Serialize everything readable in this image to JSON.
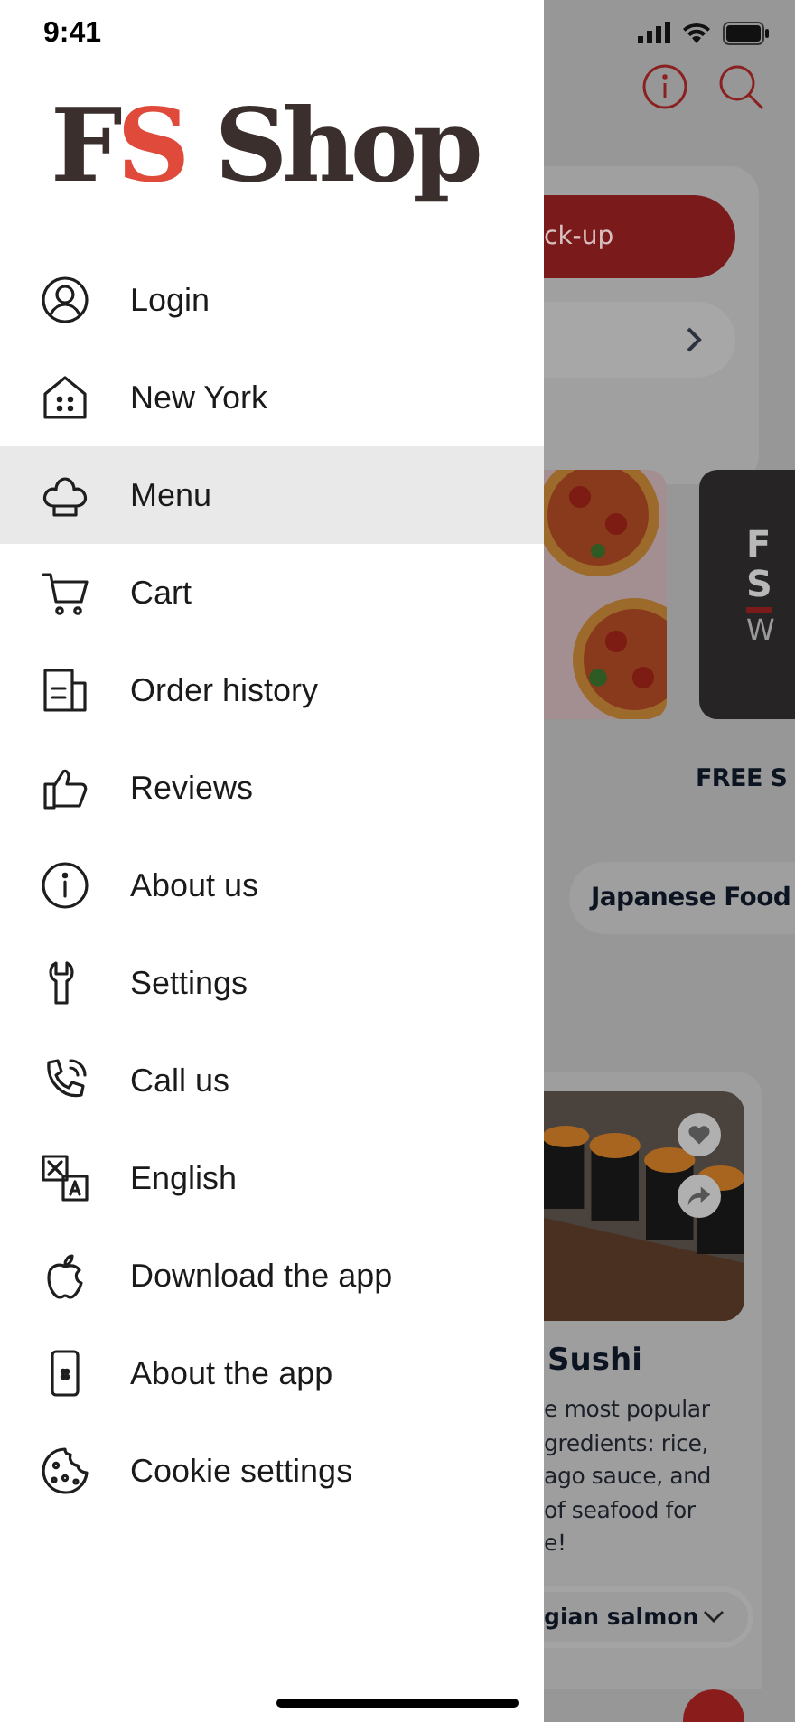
{
  "status_bar": {
    "time": "9:41"
  },
  "logo": {
    "lead": "F",
    "accent": "S",
    "name": "Shop"
  },
  "menu": [
    {
      "label": "Login",
      "selected": false
    },
    {
      "label": "New York",
      "selected": false
    },
    {
      "label": "Menu",
      "selected": true
    },
    {
      "label": "Cart",
      "selected": false
    },
    {
      "label": "Order history",
      "selected": false
    },
    {
      "label": "Reviews",
      "selected": false
    },
    {
      "label": "About us",
      "selected": false
    },
    {
      "label": "Settings",
      "selected": false
    },
    {
      "label": "Call us",
      "selected": false
    },
    {
      "label": "English",
      "selected": false
    },
    {
      "label": "Download the app",
      "selected": false
    },
    {
      "label": "About the app",
      "selected": false
    },
    {
      "label": "Cookie settings",
      "selected": false
    }
  ],
  "background_page": {
    "order_button": "ck-up",
    "promo_card_letters": [
      "F",
      "S",
      "W"
    ],
    "banner": "FREE S",
    "category_chip": "Japanese Food",
    "product": {
      "title": "Sushi",
      "description": [
        "e most popular",
        "gredients: rice,",
        "ago sauce, and",
        "of seafood for",
        "e!"
      ],
      "option": "gian salmon"
    }
  }
}
